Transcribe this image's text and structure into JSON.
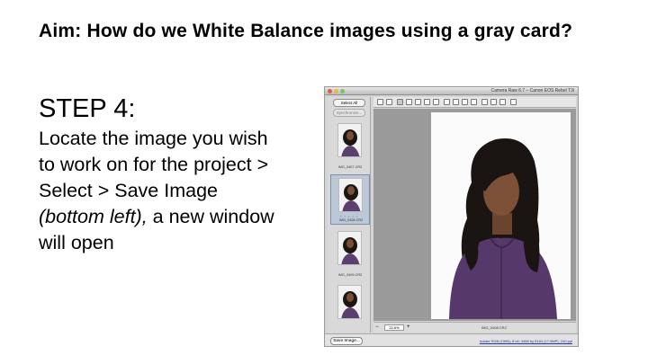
{
  "slide": {
    "title": "Aim: How do we White Balance images using a gray card?",
    "step_heading": "STEP 4:",
    "instruction_before": "Locate the image you wish to work on for the project > Select > Save Image ",
    "instruction_italic": "(bottom left),",
    "instruction_after": " a new window will open"
  },
  "screenshot": {
    "window_title": "Camera Raw 6.7 – Canon EOS Rebel T3i",
    "buttons": {
      "select_all": "Select All",
      "synchronize": "Synchronize...",
      "save_image": "Save Image..."
    },
    "thumbnails": [
      {
        "label": "IMG_0407.CR2"
      },
      {
        "label": "IMG_0408.CR2",
        "selected": true,
        "rating_dots": "• • • • •"
      },
      {
        "label": "IMG_0409.CR2"
      },
      {
        "label": ""
      }
    ],
    "zoom_value": "22.6%",
    "file_name": "IMG_0408.CR2",
    "workflow_link": "Adobe RGB (1998); 8 bit; 3456 by 5184 (17.9MP); 240 ppi",
    "colors": {
      "window_bg": "#d4d4d4",
      "preview_bg": "#9a9a9a",
      "selection": "#bcc8d8",
      "link": "#2233aa"
    }
  }
}
